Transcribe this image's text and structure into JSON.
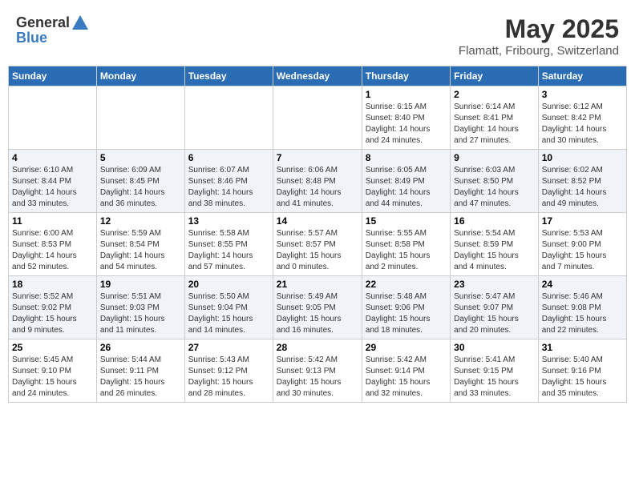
{
  "header": {
    "logo_general": "General",
    "logo_blue": "Blue",
    "title": "May 2025",
    "subtitle": "Flamatt, Fribourg, Switzerland"
  },
  "weekdays": [
    "Sunday",
    "Monday",
    "Tuesday",
    "Wednesday",
    "Thursday",
    "Friday",
    "Saturday"
  ],
  "weeks": [
    [
      {
        "day": "",
        "info": ""
      },
      {
        "day": "",
        "info": ""
      },
      {
        "day": "",
        "info": ""
      },
      {
        "day": "",
        "info": ""
      },
      {
        "day": "1",
        "info": "Sunrise: 6:15 AM\nSunset: 8:40 PM\nDaylight: 14 hours\nand 24 minutes."
      },
      {
        "day": "2",
        "info": "Sunrise: 6:14 AM\nSunset: 8:41 PM\nDaylight: 14 hours\nand 27 minutes."
      },
      {
        "day": "3",
        "info": "Sunrise: 6:12 AM\nSunset: 8:42 PM\nDaylight: 14 hours\nand 30 minutes."
      }
    ],
    [
      {
        "day": "4",
        "info": "Sunrise: 6:10 AM\nSunset: 8:44 PM\nDaylight: 14 hours\nand 33 minutes."
      },
      {
        "day": "5",
        "info": "Sunrise: 6:09 AM\nSunset: 8:45 PM\nDaylight: 14 hours\nand 36 minutes."
      },
      {
        "day": "6",
        "info": "Sunrise: 6:07 AM\nSunset: 8:46 PM\nDaylight: 14 hours\nand 38 minutes."
      },
      {
        "day": "7",
        "info": "Sunrise: 6:06 AM\nSunset: 8:48 PM\nDaylight: 14 hours\nand 41 minutes."
      },
      {
        "day": "8",
        "info": "Sunrise: 6:05 AM\nSunset: 8:49 PM\nDaylight: 14 hours\nand 44 minutes."
      },
      {
        "day": "9",
        "info": "Sunrise: 6:03 AM\nSunset: 8:50 PM\nDaylight: 14 hours\nand 47 minutes."
      },
      {
        "day": "10",
        "info": "Sunrise: 6:02 AM\nSunset: 8:52 PM\nDaylight: 14 hours\nand 49 minutes."
      }
    ],
    [
      {
        "day": "11",
        "info": "Sunrise: 6:00 AM\nSunset: 8:53 PM\nDaylight: 14 hours\nand 52 minutes."
      },
      {
        "day": "12",
        "info": "Sunrise: 5:59 AM\nSunset: 8:54 PM\nDaylight: 14 hours\nand 54 minutes."
      },
      {
        "day": "13",
        "info": "Sunrise: 5:58 AM\nSunset: 8:55 PM\nDaylight: 14 hours\nand 57 minutes."
      },
      {
        "day": "14",
        "info": "Sunrise: 5:57 AM\nSunset: 8:57 PM\nDaylight: 15 hours\nand 0 minutes."
      },
      {
        "day": "15",
        "info": "Sunrise: 5:55 AM\nSunset: 8:58 PM\nDaylight: 15 hours\nand 2 minutes."
      },
      {
        "day": "16",
        "info": "Sunrise: 5:54 AM\nSunset: 8:59 PM\nDaylight: 15 hours\nand 4 minutes."
      },
      {
        "day": "17",
        "info": "Sunrise: 5:53 AM\nSunset: 9:00 PM\nDaylight: 15 hours\nand 7 minutes."
      }
    ],
    [
      {
        "day": "18",
        "info": "Sunrise: 5:52 AM\nSunset: 9:02 PM\nDaylight: 15 hours\nand 9 minutes."
      },
      {
        "day": "19",
        "info": "Sunrise: 5:51 AM\nSunset: 9:03 PM\nDaylight: 15 hours\nand 11 minutes."
      },
      {
        "day": "20",
        "info": "Sunrise: 5:50 AM\nSunset: 9:04 PM\nDaylight: 15 hours\nand 14 minutes."
      },
      {
        "day": "21",
        "info": "Sunrise: 5:49 AM\nSunset: 9:05 PM\nDaylight: 15 hours\nand 16 minutes."
      },
      {
        "day": "22",
        "info": "Sunrise: 5:48 AM\nSunset: 9:06 PM\nDaylight: 15 hours\nand 18 minutes."
      },
      {
        "day": "23",
        "info": "Sunrise: 5:47 AM\nSunset: 9:07 PM\nDaylight: 15 hours\nand 20 minutes."
      },
      {
        "day": "24",
        "info": "Sunrise: 5:46 AM\nSunset: 9:08 PM\nDaylight: 15 hours\nand 22 minutes."
      }
    ],
    [
      {
        "day": "25",
        "info": "Sunrise: 5:45 AM\nSunset: 9:10 PM\nDaylight: 15 hours\nand 24 minutes."
      },
      {
        "day": "26",
        "info": "Sunrise: 5:44 AM\nSunset: 9:11 PM\nDaylight: 15 hours\nand 26 minutes."
      },
      {
        "day": "27",
        "info": "Sunrise: 5:43 AM\nSunset: 9:12 PM\nDaylight: 15 hours\nand 28 minutes."
      },
      {
        "day": "28",
        "info": "Sunrise: 5:42 AM\nSunset: 9:13 PM\nDaylight: 15 hours\nand 30 minutes."
      },
      {
        "day": "29",
        "info": "Sunrise: 5:42 AM\nSunset: 9:14 PM\nDaylight: 15 hours\nand 32 minutes."
      },
      {
        "day": "30",
        "info": "Sunrise: 5:41 AM\nSunset: 9:15 PM\nDaylight: 15 hours\nand 33 minutes."
      },
      {
        "day": "31",
        "info": "Sunrise: 5:40 AM\nSunset: 9:16 PM\nDaylight: 15 hours\nand 35 minutes."
      }
    ]
  ]
}
